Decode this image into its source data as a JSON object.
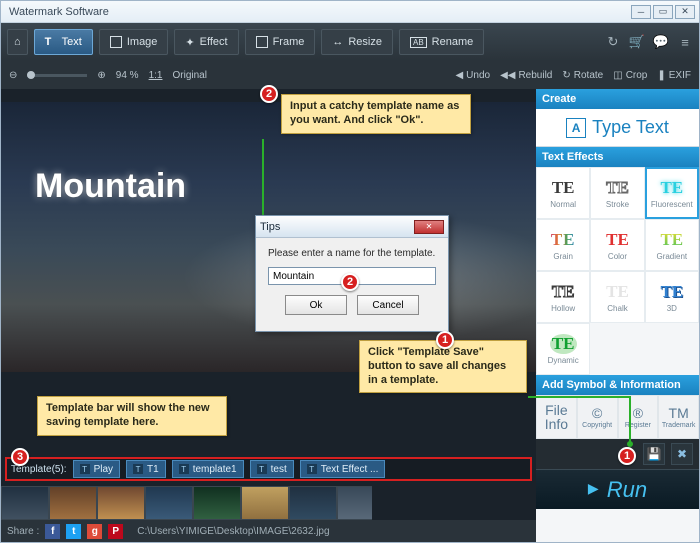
{
  "app": {
    "title": "Watermark Software"
  },
  "toolbar": {
    "home": "⌂",
    "text": "Text",
    "image": "Image",
    "effect": "Effect",
    "frame": "Frame",
    "resize": "Resize",
    "rename": "Rename"
  },
  "zoom": {
    "percent": "94 %",
    "ratio": "1:1",
    "ratio_label": "Original",
    "undo": "Undo",
    "rebuild": "Rebuild",
    "rotate": "Rotate",
    "crop": "Crop",
    "exif": "EXIF"
  },
  "canvas": {
    "watermark": "Mountain"
  },
  "rpanel": {
    "create": "Create",
    "type_text": "Type Text",
    "text_effects": "Text Effects",
    "effects": [
      {
        "swatch": "TE",
        "label": "Normal",
        "style": "color:#3a3a3a"
      },
      {
        "swatch": "TE",
        "label": "Stroke",
        "style": "color:#888;-webkit-text-stroke:1px #666;color:transparent"
      },
      {
        "swatch": "TE",
        "label": "Fluorescent",
        "style": "color:#2ad0e0;text-shadow:0 0 4px #2ad0e0",
        "sel": true
      },
      {
        "swatch": "TE",
        "label": "Grain",
        "style": "background:linear-gradient(90deg,#d04060,#e08030,#40a060,#3080d0);-webkit-background-clip:text;color:transparent;letter-spacing:1px"
      },
      {
        "swatch": "TE",
        "label": "Color",
        "style": "color:#e03030"
      },
      {
        "swatch": "TE",
        "label": "Gradient",
        "style": "background:linear-gradient(#f0e030,#40c060);-webkit-background-clip:text;color:transparent"
      },
      {
        "swatch": "TE",
        "label": "Hollow",
        "style": "color:transparent;-webkit-text-stroke:1px #3a3a3a"
      },
      {
        "swatch": "TE",
        "label": "Chalk",
        "style": "color:#e4e4e4"
      },
      {
        "swatch": "TE",
        "label": "3D",
        "style": "color:#3080d0;text-shadow:1px 1px 0 #1a5090"
      },
      {
        "swatch": "TE",
        "label": "Dynamic",
        "style": "color:#10a030;background:#c0e8c0;border-radius:50%;padding:0 2px"
      }
    ],
    "add_symbol": "Add Symbol & Information",
    "addl": [
      {
        "big": "File\nInfo",
        "label": ""
      },
      {
        "big": "©",
        "label": "Copyright"
      },
      {
        "big": "®",
        "label": "Register"
      },
      {
        "big": "TM",
        "label": "Trademark"
      }
    ]
  },
  "templates": {
    "label": "Template(5):",
    "items": [
      "Play",
      "T1",
      "template1",
      "test",
      "Text Effect ..."
    ]
  },
  "share": {
    "label": "Share :",
    "path": "C:\\Users\\YIMIGE\\Desktop\\IMAGE\\2632.jpg"
  },
  "run": "Run",
  "dialog": {
    "title": "Tips",
    "msg": "Please enter a name for the template.",
    "value": "Mountain",
    "ok": "Ok",
    "cancel": "Cancel"
  },
  "callouts": {
    "c1": "Click \"Template Save\" button to save all changes in a template.",
    "c2": "Input a catchy template name as you want. And click \"Ok\".",
    "c3": "Template bar will show the new saving template here."
  }
}
